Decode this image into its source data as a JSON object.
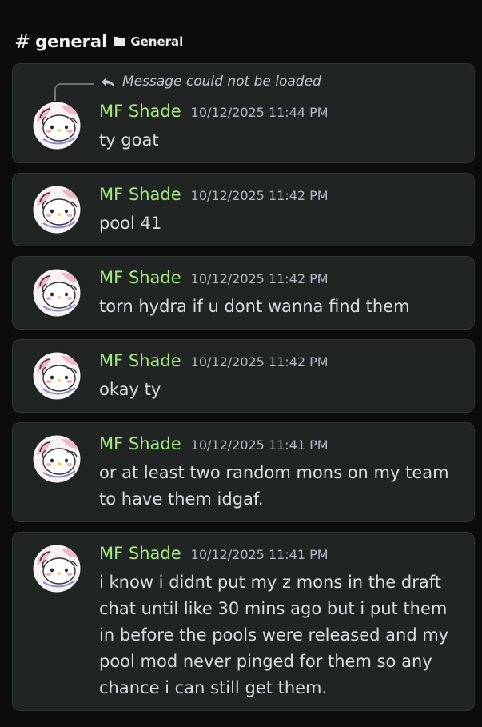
{
  "header": {
    "hash": "#",
    "channel": "general",
    "category": "General"
  },
  "messages": [
    {
      "reply_notice": "Message could not be loaded",
      "author": "MF Shade",
      "timestamp": "10/12/2025 11:44 PM",
      "text": "ty goat"
    },
    {
      "author": "MF Shade",
      "timestamp": "10/12/2025 11:42 PM",
      "text": "pool 41"
    },
    {
      "author": "MF Shade",
      "timestamp": "10/12/2025 11:42 PM",
      "text": "torn hydra if u dont wanna find them"
    },
    {
      "author": "MF Shade",
      "timestamp": "10/12/2025 11:42 PM",
      "text": "okay ty"
    },
    {
      "author": "MF Shade",
      "timestamp": "10/12/2025 11:41 PM",
      "text": "or at least two random mons on my team to have them idgaf."
    },
    {
      "author": "MF Shade",
      "timestamp": "10/12/2025 11:41 PM",
      "text": "i know i didnt put my z mons in the draft chat until like 30 mins ago but i put them in before the pools were released and my pool mod never pinged for them so any chance i can still get them."
    }
  ],
  "colors": {
    "background": "#0b0d0c",
    "card": "#202524",
    "author": "#a5e87d",
    "timestamp": "#b5bac1"
  }
}
